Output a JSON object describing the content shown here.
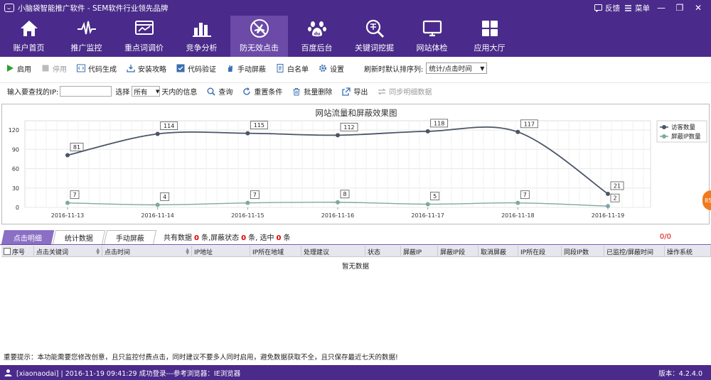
{
  "titlebar": {
    "title": "小脑袋智能推广软件 - SEM软件行业领先品牌",
    "feedback": "反馈",
    "menu": "菜单",
    "minimize": "—",
    "restore": "❐",
    "close": "✕"
  },
  "nav": {
    "items": [
      {
        "label": "账户首页",
        "icon": "home-icon"
      },
      {
        "label": "推广监控",
        "icon": "pulse-icon"
      },
      {
        "label": "重点词调价",
        "icon": "screen-chart-icon"
      },
      {
        "label": "竞争分析",
        "icon": "bar-chart-icon"
      },
      {
        "label": "防无效点击",
        "icon": "no-plane-icon"
      },
      {
        "label": "百度后台",
        "icon": "baidu-paw-icon"
      },
      {
        "label": "关键词挖掘",
        "icon": "search-word-icon"
      },
      {
        "label": "网站体检",
        "icon": "monitor-icon"
      },
      {
        "label": "应用大厅",
        "icon": "grid-icon"
      }
    ],
    "active_index": 4
  },
  "toolbar": {
    "enable": "启用",
    "disable": "停用",
    "gen_code": "代码生成",
    "install_guide": "安装攻略",
    "verify_code": "代码验证",
    "manual_block": "手动屏蔽",
    "whitelist": "白名单",
    "settings": "设置",
    "sort_label": "刷新时默认排序列:",
    "sort_value": "统计/点击时间"
  },
  "search": {
    "ip_label": "输入要查找的IP:",
    "select_label": "选择",
    "range_value": "所有",
    "within_label": "天内的信息",
    "query": "查询",
    "reset": "重置条件",
    "batch_delete": "批量删除",
    "export": "导出",
    "sync": "同步明细数据"
  },
  "chart_data": {
    "type": "line",
    "title": "网站流量和屏蔽效果图",
    "categories": [
      "2016-11-13",
      "2016-11-14",
      "2016-11-15",
      "2016-11-16",
      "2016-11-17",
      "2016-11-18",
      "2016-11-19"
    ],
    "series": [
      {
        "name": "访客数量",
        "values": [
          81,
          114,
          115,
          112,
          118,
          117,
          21
        ],
        "color": "#4a5566"
      },
      {
        "name": "屏蔽IP数量",
        "values": [
          7,
          4,
          7,
          8,
          5,
          7,
          2
        ],
        "color": "#7fa8a0"
      }
    ],
    "yticks": [
      0,
      30,
      60,
      90,
      120
    ],
    "ylim": [
      0,
      130
    ],
    "grid": true,
    "legend": "top-right"
  },
  "tabs": {
    "items": [
      "点击明细",
      "统计数据",
      "手动屏蔽"
    ],
    "active_index": 0
  },
  "stats": {
    "total_prefix": "共有数据",
    "total": "0",
    "total_suffix": "条,屏蔽状态",
    "blocked": "0",
    "blocked_suffix": "条, 选中",
    "selected": "0",
    "selected_suffix": "条",
    "page": "0/0"
  },
  "table": {
    "columns": [
      "序号",
      "点击关键词",
      "点击时间",
      "IP地址",
      "IP所在地域",
      "处理建议",
      "状态",
      "屏蔽IP",
      "屏蔽IP段",
      "取消屏蔽",
      "IP所在段",
      "同段IP数",
      "已监控/屏蔽时间",
      "操作系统"
    ],
    "empty_text": "暂无数据"
  },
  "notice": "重要提示：本功能需要您修改创意，且只监控付费点击，同时建议不要多人同时启用，避免数据获取不全，且只保存最近七天的数据!",
  "statusbar": {
    "text": "[xiaonaodai] | 2016-11-19 09:41:29 成功登录---参考浏览器：IE浏览器",
    "version": "版本：4.2.4.0"
  },
  "side_badge": "85"
}
